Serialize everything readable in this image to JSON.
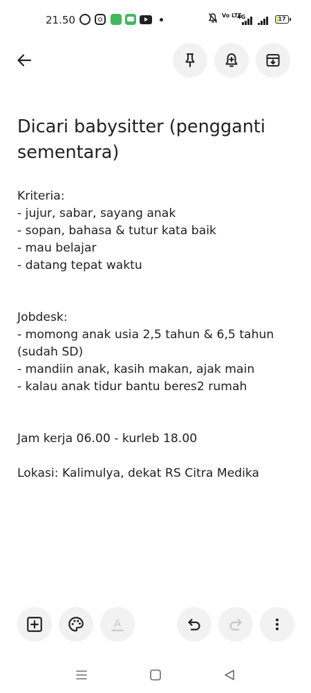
{
  "status_bar": {
    "time": "21.50",
    "network_volte": "Vo LTE",
    "network_type": "4G",
    "battery_level": "17",
    "battery_fraction": 0.17,
    "notification_icons": [
      "whatsapp-icon",
      "instagram-icon",
      "green-app-icon",
      "green-chat-icon",
      "youtube-icon",
      "more-notifications-dot"
    ],
    "status_icons": [
      "mute-icon",
      "volte-icon",
      "signal-4g-icon",
      "signal-icon",
      "battery-icon"
    ]
  },
  "toolbar": {
    "back_icon": "arrow-back-icon",
    "pin_icon": "pin-icon",
    "reminder_icon": "reminder-bell-icon",
    "archive_icon": "archive-icon"
  },
  "note": {
    "title_line1": "Dicari babysitter (pengganti",
    "title_line2": "sementara)",
    "body": [
      "Kriteria:",
      "- jujur, sabar, sayang anak",
      "- sopan, bahasa & tutur kata baik",
      "- mau belajar",
      "- datang tepat waktu",
      "",
      "",
      "Jobdesk:",
      "- momong anak usia 2,5 tahun & 6,5 tahun",
      "(sudah SD)",
      "- mandiin anak, kasih makan, ajak main",
      "- kalau anak tidur bantu beres2 rumah",
      "",
      "",
      "Jam kerja 06.00 - kurleb 18.00",
      "",
      "Lokasi: Kalimulya, dekat RS Citra Medika"
    ]
  },
  "bottom_toolbar": {
    "add_icon": "add-box-icon",
    "palette_icon": "palette-icon",
    "text_format_icon": "text-format-icon",
    "text_format_glyph": "A",
    "undo_icon": "undo-icon",
    "redo_icon": "redo-icon",
    "more_icon": "more-vert-icon"
  },
  "system_nav": {
    "recents_icon": "menu-icon",
    "home_icon": "home-square-icon",
    "back_icon": "back-triangle-icon"
  },
  "colors": {
    "background": "#ffffff",
    "text": "#202124",
    "button_bg": "#f2f2f2",
    "disabled_icon": "#c4c7c5",
    "app_green": "#3fba5b",
    "battery_fill": "#e6d94c"
  }
}
